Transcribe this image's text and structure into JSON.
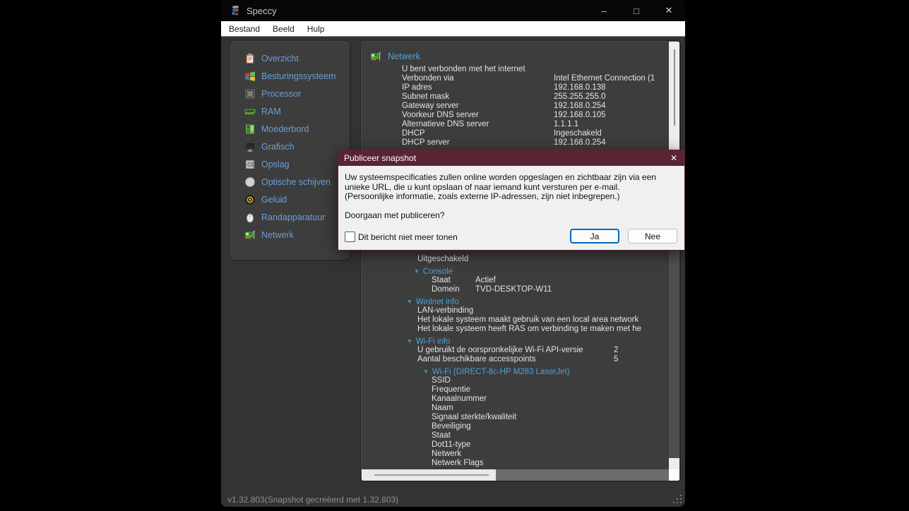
{
  "window": {
    "title": "Speccy",
    "menu": [
      "Bestand",
      "Beeld",
      "Hulp"
    ],
    "controls": {
      "minimize": "–",
      "maximize": "□",
      "close": "✕"
    },
    "status": "v1.32.803(Snapshot gecreëerd met 1.32.803)"
  },
  "sidebar": {
    "items": [
      {
        "label": "Overzicht",
        "icon": "clipboard-icon"
      },
      {
        "label": "Besturingssysteem",
        "icon": "windows-icon"
      },
      {
        "label": "Processor",
        "icon": "cpu-icon"
      },
      {
        "label": "RAM",
        "icon": "ram-icon"
      },
      {
        "label": "Moederbord",
        "icon": "motherboard-icon"
      },
      {
        "label": "Grafisch",
        "icon": "monitor-icon"
      },
      {
        "label": "Opslag",
        "icon": "harddrive-icon"
      },
      {
        "label": "Optische schijven",
        "icon": "disc-icon"
      },
      {
        "label": "Geluid",
        "icon": "speaker-icon"
      },
      {
        "label": "Randapparatuur",
        "icon": "mouse-icon"
      },
      {
        "label": "Netwerk",
        "icon": "network-icon"
      }
    ]
  },
  "network_panel": {
    "header": {
      "label": "Netwerk",
      "icon": "network-icon"
    },
    "rows": [
      {
        "kind": "text",
        "lvl": "l1",
        "label": "U bent verbonden met het internet"
      },
      {
        "kind": "kv",
        "lvl": "l1",
        "vcol": "v1",
        "label": "Verbonden via",
        "value": "Intel Ethernet Connection (1"
      },
      {
        "kind": "kv",
        "lvl": "l1",
        "vcol": "v1",
        "label": "IP adres",
        "value": "192.168.0.138"
      },
      {
        "kind": "kv",
        "lvl": "l1",
        "vcol": "v1",
        "label": "Subnet mask",
        "value": "255.255.255.0"
      },
      {
        "kind": "kv",
        "lvl": "l1",
        "vcol": "v1",
        "label": "Gateway server",
        "value": "192.168.0.254"
      },
      {
        "kind": "kv",
        "lvl": "l1",
        "vcol": "v1",
        "label": "Voorkeur DNS server",
        "value": "192.168.0.105"
      },
      {
        "kind": "kv",
        "lvl": "l1",
        "vcol": "v1",
        "label": "Alternatieve DNS server",
        "value": "1.1.1.1"
      },
      {
        "kind": "kv",
        "lvl": "l1",
        "vcol": "v1",
        "label": "DHCP",
        "value": "Ingeschakeld"
      },
      {
        "kind": "kv",
        "lvl": "l1",
        "vcol": "v1",
        "label": "DHCP server",
        "value": "192.168.0.254"
      },
      {
        "kind": "text",
        "lvl": "l2",
        "gap": true,
        "label": "Uitgeschakeld"
      },
      {
        "kind": "sec",
        "lvl": "hA",
        "label": "Console"
      },
      {
        "kind": "kv",
        "lvl": "l3",
        "vcol": "v2",
        "label": "Staat",
        "value": "Actief"
      },
      {
        "kind": "kv",
        "lvl": "l3",
        "vcol": "v2",
        "label": "Domein",
        "value": "TVD-DESKTOP-W11"
      },
      {
        "kind": "sec",
        "lvl": "hB",
        "label": "WinInet info"
      },
      {
        "kind": "text",
        "lvl": "l2",
        "label": "LAN-verbinding"
      },
      {
        "kind": "text",
        "lvl": "l2",
        "label": "Het lokale systeem maakt gebruik van een local area network"
      },
      {
        "kind": "text",
        "lvl": "l2",
        "label": "Het lokale systeem heeft RAS om verbinding te maken met he"
      },
      {
        "kind": "sec",
        "lvl": "hB",
        "label": "Wi-Fi info"
      },
      {
        "kind": "kv",
        "lvl": "l2",
        "vcol": "v3",
        "label": "U gebruikt de oorspronkelijke Wi-Fi API-versie",
        "value": "2"
      },
      {
        "kind": "kv",
        "lvl": "l2",
        "vcol": "v3",
        "label": "Aantal beschikbare accesspoints",
        "value": "5"
      },
      {
        "kind": "sec",
        "lvl": "hC",
        "label": "Wi-Fi (DIRECT-8c-HP M283 LaserJet)"
      },
      {
        "kind": "text",
        "lvl": "l3",
        "label": "SSID"
      },
      {
        "kind": "text",
        "lvl": "l3",
        "label": "Frequentie"
      },
      {
        "kind": "text",
        "lvl": "l3",
        "label": "Kanaalnummer"
      },
      {
        "kind": "text",
        "lvl": "l3",
        "label": "Naam"
      },
      {
        "kind": "text",
        "lvl": "l3",
        "label": "Signaal sterkte/kwaliteit"
      },
      {
        "kind": "text",
        "lvl": "l3",
        "label": "Beveiliging"
      },
      {
        "kind": "text",
        "lvl": "l3",
        "label": "Staat"
      },
      {
        "kind": "text",
        "lvl": "l3",
        "label": "Dot11-type"
      },
      {
        "kind": "text",
        "lvl": "l3",
        "label": "Netwerk"
      },
      {
        "kind": "text",
        "lvl": "l3",
        "label": "Netwerk Flags"
      }
    ]
  },
  "dialog": {
    "title": "Publiceer snapshot",
    "close": "✕",
    "body_line1": "Uw systeemspecificaties zullen online worden opgeslagen en zichtbaar zijn via een unieke URL, die u kunt opslaan of naar iemand kunt versturen per e-mail.",
    "body_line2": "(Persoonlijke informatie, zoals externe IP-adressen, zijn niet inbegrepen.)",
    "question": "Doorgaan met publiceren?",
    "checkbox_label": "Dit bericht niet meer tonen",
    "checkbox_checked": false,
    "buttons": {
      "yes": "Ja",
      "no": "Nee"
    }
  },
  "colors": {
    "sidebar_link": "#6d9ed6",
    "section_blue": "#4da2d8",
    "body_text": "#e4e4e4",
    "dialog_title_bg": "#5a2433",
    "default_button_border": "#0067c0",
    "panel_bg": "#3d3d3d",
    "titlebar_bg": "#070707"
  }
}
